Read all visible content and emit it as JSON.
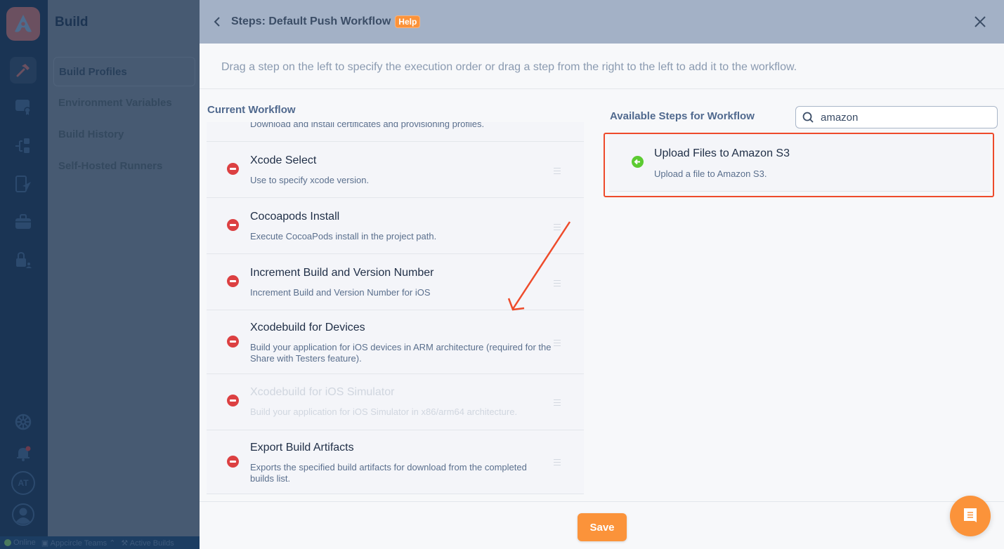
{
  "app": {
    "section_title": "Build",
    "subnav_items": [
      {
        "label": "Build Profiles",
        "active": true
      },
      {
        "label": "Environment Variables",
        "active": false
      },
      {
        "label": "Build History",
        "active": false
      },
      {
        "label": "Self-Hosted Runners",
        "active": false
      }
    ],
    "rail_icons": [
      "build-hammer-icon",
      "signing-identities-icon",
      "distribution-icon",
      "testing-distribution-icon",
      "store-submit-icon",
      "enterprise-store-icon"
    ],
    "rail_bottom": {
      "avatar_initials": "AT"
    },
    "statusbar": {
      "online": "Online",
      "organization": "Appcircle Teams",
      "active_builds": "Active Builds"
    }
  },
  "drawer": {
    "title": "Steps: Default Push Workflow",
    "help_label": "Help",
    "instructions": "Drag a step on the left to specify the execution order or drag a step from the right to the left to add it to the workflow.",
    "current_workflow": {
      "title": "Current Workflow",
      "partial_step_desc": "Download and install certificates and provisioning profiles.",
      "steps": [
        {
          "name": "Xcode Select",
          "desc": "Use to specify xcode version.",
          "disabled": false
        },
        {
          "name": "Cocoapods Install",
          "desc": "Execute CocoaPods install in the project path.",
          "disabled": false
        },
        {
          "name": "Increment Build and Version Number",
          "desc": "Increment Build and Version Number for iOS",
          "disabled": false
        },
        {
          "name": "Xcodebuild for Devices",
          "desc": "Build your application for iOS devices in ARM architecture (required for the Share with Testers feature).",
          "disabled": false
        },
        {
          "name": "Xcodebuild for iOS Simulator",
          "desc": "Build your application for iOS Simulator in x86/arm64 architecture.",
          "disabled": true
        },
        {
          "name": "Export Build Artifacts",
          "desc": "Exports the specified build artifacts for download from the completed builds list.",
          "disabled": false
        }
      ]
    },
    "available_steps": {
      "title": "Available Steps for Workflow",
      "search_value": "amazon",
      "steps": [
        {
          "name": "Upload Files to Amazon S3",
          "desc": "Upload a file to Amazon S3."
        }
      ]
    },
    "save_label": "Save"
  },
  "colors": {
    "accent_orange": "#fb933a",
    "remove_red": "#dc4042",
    "add_green": "#5ccb32",
    "annotation_red": "#ee4b2b"
  }
}
